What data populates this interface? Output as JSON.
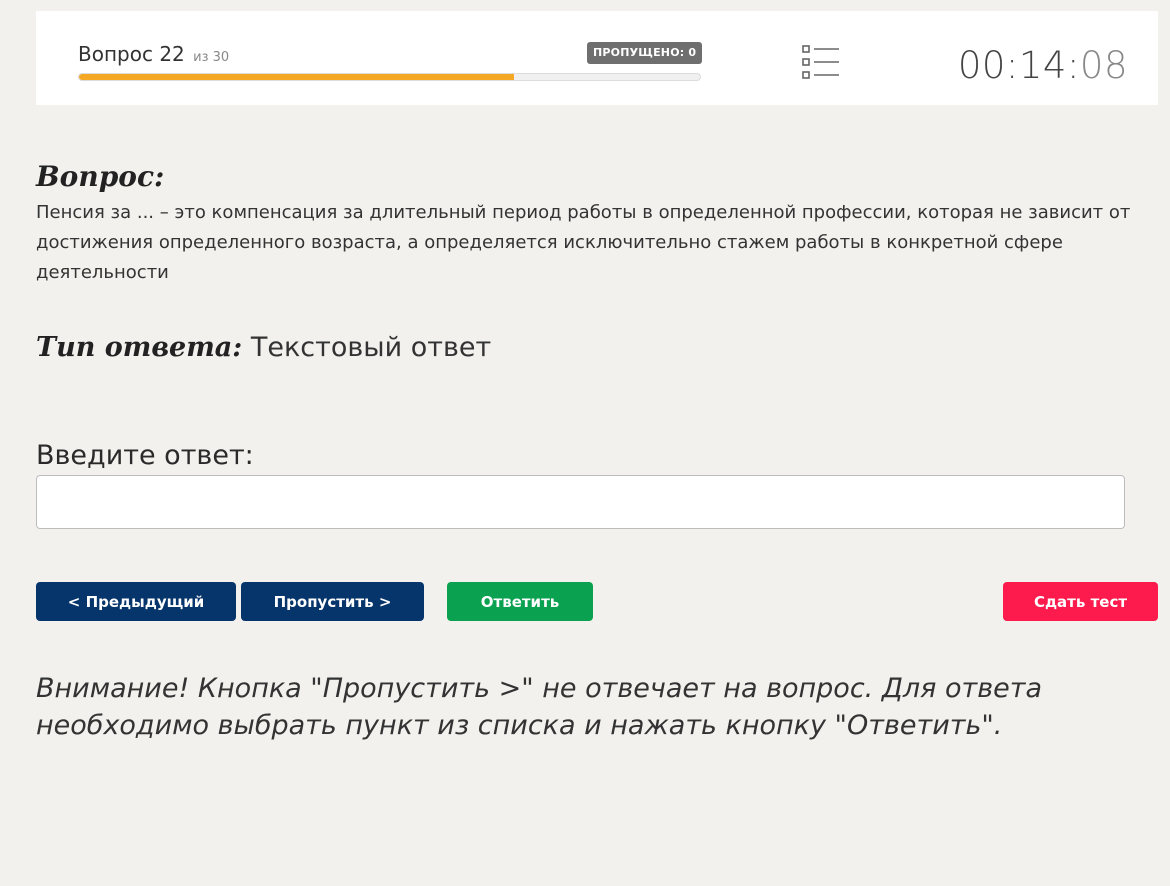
{
  "header": {
    "question_label": "Вопрос 22",
    "question_of": "из 30",
    "skipped_badge": "ПРОПУЩЕНО: 0",
    "progress_fraction": 0.7,
    "timer_main": "00:14:",
    "timer_seconds": "08"
  },
  "question": {
    "heading": "Вопрос:",
    "text": "Пенсия за ... – это компенсация за длительный период работы в определенной профессии, которая не зависит от достижения определенного возраста, а определяется исключительно стажем работы в конкретной сфере деятельности"
  },
  "answer_type": {
    "label": "Тип ответа:",
    "value": " Текстовый ответ"
  },
  "answer_input": {
    "label": "Введите ответ:",
    "value": ""
  },
  "buttons": {
    "prev": "< Предыдущий",
    "skip": "Пропустить >",
    "answer": "Ответить",
    "submit": "Сдать тест"
  },
  "warning": "Внимание! Кнопка \"Пропустить >\" не отвечает на вопрос. Для ответа необходимо выбрать пункт из списка и нажать кнопку \"Ответить\".",
  "colors": {
    "progress": "#f4a823",
    "nav_button": "#06356b",
    "answer_button": "#0aa150",
    "submit_button": "#fc1b4c"
  },
  "icons": {
    "question_list": "list-icon"
  }
}
